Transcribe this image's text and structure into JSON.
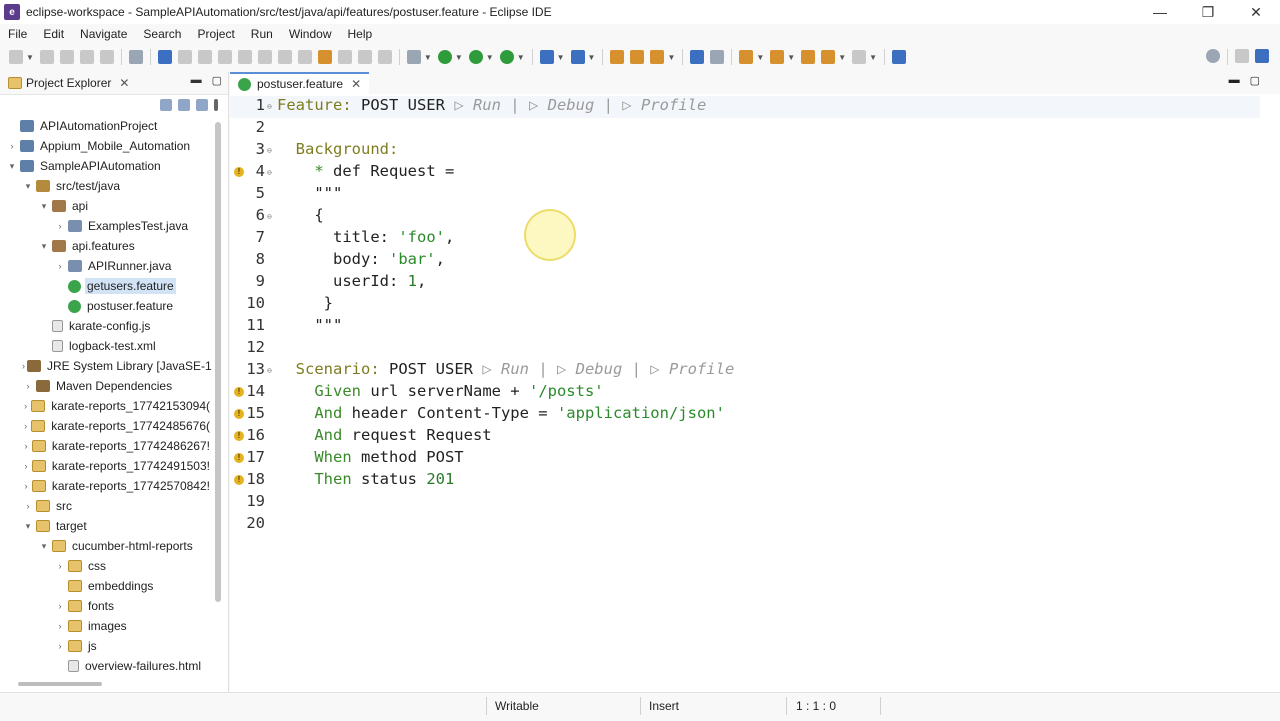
{
  "window": {
    "title": "eclipse-workspace - SampleAPIAutomation/src/test/java/api/features/postuser.feature - Eclipse IDE",
    "minimize": "—",
    "maximize": "❐",
    "close": "✕"
  },
  "menu": [
    "File",
    "Edit",
    "Navigate",
    "Search",
    "Project",
    "Run",
    "Window",
    "Help"
  ],
  "explorer": {
    "title": "Project Explorer",
    "close": "✕",
    "tree": [
      {
        "label": "APIAutomationProject",
        "indent": 0,
        "twisty": "",
        "icon": "proj"
      },
      {
        "label": "Appium_Mobile_Automation",
        "indent": 0,
        "twisty": "›",
        "icon": "proj"
      },
      {
        "label": "SampleAPIAutomation",
        "indent": 0,
        "twisty": "⌄",
        "icon": "proj"
      },
      {
        "label": "src/test/java",
        "indent": 1,
        "twisty": "⌄",
        "icon": "srcfolder"
      },
      {
        "label": "api",
        "indent": 2,
        "twisty": "⌄",
        "icon": "pkg"
      },
      {
        "label": "ExamplesTest.java",
        "indent": 3,
        "twisty": "›",
        "icon": "java"
      },
      {
        "label": "api.features",
        "indent": 2,
        "twisty": "⌄",
        "icon": "pkg"
      },
      {
        "label": "APIRunner.java",
        "indent": 3,
        "twisty": "›",
        "icon": "java"
      },
      {
        "label": "getusers.feature",
        "indent": 3,
        "twisty": "",
        "icon": "feature",
        "selected": true
      },
      {
        "label": "postuser.feature",
        "indent": 3,
        "twisty": "",
        "icon": "feature"
      },
      {
        "label": "karate-config.js",
        "indent": 2,
        "twisty": "",
        "icon": "file"
      },
      {
        "label": "logback-test.xml",
        "indent": 2,
        "twisty": "",
        "icon": "file"
      },
      {
        "label": "JRE System Library [JavaSE-17",
        "indent": 1,
        "twisty": "›",
        "icon": "lib"
      },
      {
        "label": "Maven Dependencies",
        "indent": 1,
        "twisty": "›",
        "icon": "lib"
      },
      {
        "label": "karate-reports_17742153094(",
        "indent": 1,
        "twisty": "›",
        "icon": "folder"
      },
      {
        "label": "karate-reports_17742485676(",
        "indent": 1,
        "twisty": "›",
        "icon": "folder"
      },
      {
        "label": "karate-reports_17742486267!",
        "indent": 1,
        "twisty": "›",
        "icon": "folder"
      },
      {
        "label": "karate-reports_17742491503!",
        "indent": 1,
        "twisty": "›",
        "icon": "folder"
      },
      {
        "label": "karate-reports_17742570842!",
        "indent": 1,
        "twisty": "›",
        "icon": "folder"
      },
      {
        "label": "src",
        "indent": 1,
        "twisty": "›",
        "icon": "folder"
      },
      {
        "label": "target",
        "indent": 1,
        "twisty": "⌄",
        "icon": "folder"
      },
      {
        "label": "cucumber-html-reports",
        "indent": 2,
        "twisty": "⌄",
        "icon": "folder"
      },
      {
        "label": "css",
        "indent": 3,
        "twisty": "›",
        "icon": "folder"
      },
      {
        "label": "embeddings",
        "indent": 3,
        "twisty": "",
        "icon": "folder"
      },
      {
        "label": "fonts",
        "indent": 3,
        "twisty": "›",
        "icon": "folder"
      },
      {
        "label": "images",
        "indent": 3,
        "twisty": "›",
        "icon": "folder"
      },
      {
        "label": "js",
        "indent": 3,
        "twisty": "›",
        "icon": "folder"
      },
      {
        "label": "overview-failures.html",
        "indent": 3,
        "twisty": "",
        "icon": "file"
      }
    ]
  },
  "editor": {
    "tab_label": "postuser.feature",
    "tab_close": "✕",
    "lines": [
      {
        "n": "1",
        "fold": "⊖",
        "warn": false,
        "parts": [
          [
            "kw",
            "Feature:"
          ],
          [
            "plain",
            " POST USER "
          ],
          [
            "cl",
            "▷ Run | ▷ Debug | ▷ Profile"
          ]
        ]
      },
      {
        "n": "2",
        "fold": "",
        "warn": false,
        "parts": []
      },
      {
        "n": "3",
        "fold": "⊖",
        "warn": false,
        "parts": [
          [
            "plain",
            "  "
          ],
          [
            "kw",
            "Background:"
          ]
        ]
      },
      {
        "n": "4",
        "fold": "⊖",
        "warn": true,
        "parts": [
          [
            "plain",
            "    "
          ],
          [
            "kg",
            "* "
          ],
          [
            "plain",
            "def Request ="
          ]
        ]
      },
      {
        "n": "5",
        "fold": "",
        "warn": false,
        "parts": [
          [
            "plain",
            "    \"\"\""
          ]
        ]
      },
      {
        "n": "6",
        "fold": "⊖",
        "warn": false,
        "parts": [
          [
            "plain",
            "    {"
          ]
        ]
      },
      {
        "n": "7",
        "fold": "",
        "warn": false,
        "parts": [
          [
            "plain",
            "      title: "
          ],
          [
            "str",
            "'foo'"
          ],
          [
            "plain",
            ","
          ]
        ]
      },
      {
        "n": "8",
        "fold": "",
        "warn": false,
        "parts": [
          [
            "plain",
            "      body: "
          ],
          [
            "str",
            "'bar'"
          ],
          [
            "plain",
            ","
          ]
        ]
      },
      {
        "n": "9",
        "fold": "",
        "warn": false,
        "parts": [
          [
            "plain",
            "      userId: "
          ],
          [
            "num",
            "1"
          ],
          [
            "plain",
            ","
          ]
        ]
      },
      {
        "n": "10",
        "fold": "",
        "warn": false,
        "parts": [
          [
            "plain",
            "     }"
          ]
        ]
      },
      {
        "n": "11",
        "fold": "",
        "warn": false,
        "parts": [
          [
            "plain",
            "    \"\"\""
          ]
        ]
      },
      {
        "n": "12",
        "fold": "",
        "warn": false,
        "parts": []
      },
      {
        "n": "13",
        "fold": "⊖",
        "warn": false,
        "parts": [
          [
            "plain",
            "  "
          ],
          [
            "kw",
            "Scenario:"
          ],
          [
            "plain",
            " POST USER "
          ],
          [
            "cl",
            "▷ Run | ▷ Debug | ▷ Profile"
          ]
        ]
      },
      {
        "n": "14",
        "fold": "",
        "warn": true,
        "parts": [
          [
            "plain",
            "    "
          ],
          [
            "kg",
            "Given"
          ],
          [
            "plain",
            " url serverName + "
          ],
          [
            "str",
            "'/posts'"
          ]
        ]
      },
      {
        "n": "15",
        "fold": "",
        "warn": true,
        "parts": [
          [
            "plain",
            "    "
          ],
          [
            "kg",
            "And"
          ],
          [
            "plain",
            " header Content-Type = "
          ],
          [
            "str",
            "'application/json'"
          ]
        ]
      },
      {
        "n": "16",
        "fold": "",
        "warn": true,
        "parts": [
          [
            "plain",
            "    "
          ],
          [
            "kg",
            "And"
          ],
          [
            "plain",
            " request Request"
          ]
        ]
      },
      {
        "n": "17",
        "fold": "",
        "warn": true,
        "parts": [
          [
            "plain",
            "    "
          ],
          [
            "kg",
            "When"
          ],
          [
            "plain",
            " method POST"
          ]
        ]
      },
      {
        "n": "18",
        "fold": "",
        "warn": true,
        "parts": [
          [
            "plain",
            "    "
          ],
          [
            "kg",
            "Then"
          ],
          [
            "plain",
            " status "
          ],
          [
            "num",
            "201"
          ]
        ]
      },
      {
        "n": "19",
        "fold": "",
        "warn": false,
        "parts": []
      },
      {
        "n": "20",
        "fold": "",
        "warn": false,
        "parts": []
      }
    ]
  },
  "status": {
    "writable": "Writable",
    "insert": "Insert",
    "position": "1 : 1 : 0"
  }
}
